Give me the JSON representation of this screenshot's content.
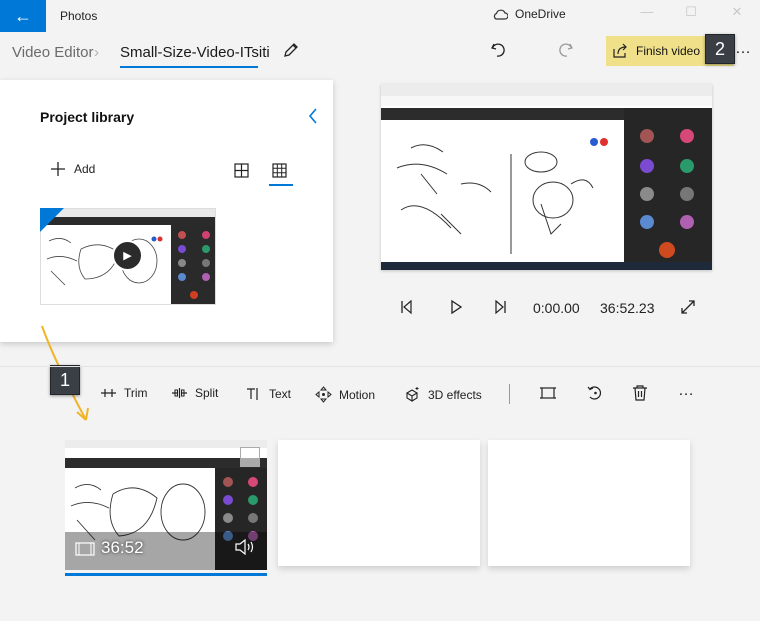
{
  "app": {
    "title": "Photos",
    "cloud_label": "OneDrive"
  },
  "window_controls": {
    "minimize": "—",
    "maximize": "☐",
    "close": "✕"
  },
  "header": {
    "breadcrumb_root": "Video Editor",
    "breadcrumb_separator": "›",
    "project_name": "Small-Size-Video-ITsiti",
    "finish_label": "Finish video",
    "more_label": "…"
  },
  "library": {
    "title": "Project library",
    "add_label": "Add"
  },
  "player": {
    "current_time": "0:00.00",
    "duration": "36:52.23"
  },
  "toolbar": {
    "trim_label": "Trim",
    "split_label": "Split",
    "text_label": "Text",
    "motion_label": "Motion",
    "effects_label": "3D effects",
    "more_label": "…"
  },
  "storyboard": {
    "clip_duration": "36:52"
  },
  "callouts": {
    "badge_1": "1",
    "badge_2": "2"
  },
  "colors": {
    "accent": "#0078d7",
    "finish_highlight": "#f0e08a",
    "arrow": "#f0b429",
    "badge_bg": "#3a3f46"
  }
}
